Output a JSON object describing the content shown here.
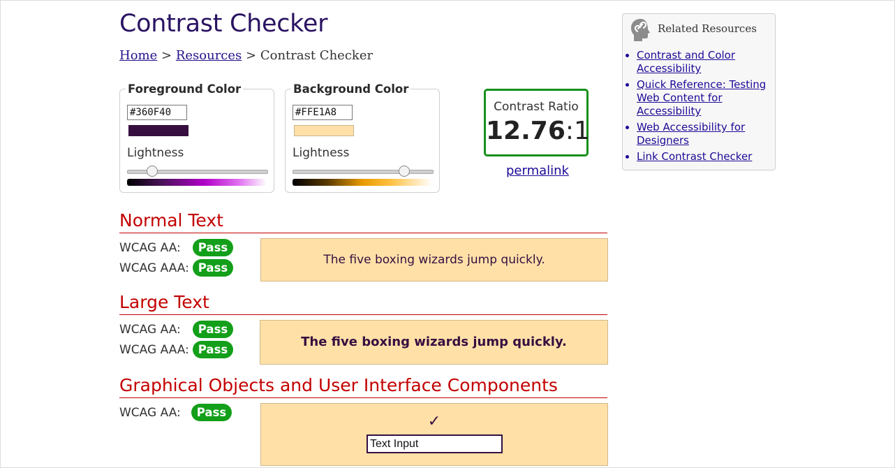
{
  "page": {
    "title": "Contrast Checker"
  },
  "breadcrumb": {
    "home": "Home",
    "sep1": ">",
    "resources": "Resources",
    "sep2": ">",
    "current": "Contrast Checker"
  },
  "foreground": {
    "legend": "Foreground Color",
    "hex": "#360F40",
    "swatch_color": "#360F40",
    "lightness_label": "Lightness",
    "lightness_value": 0.18
  },
  "background": {
    "legend": "Background Color",
    "hex": "#FFE1A8",
    "swatch_color": "#FFE1A8",
    "lightness_label": "Lightness",
    "lightness_value": 0.8
  },
  "ratio": {
    "label": "Contrast Ratio",
    "value": "12.76",
    "suffix": ":1",
    "permalink": "permalink"
  },
  "normal": {
    "heading": "Normal Text",
    "aa_label": "WCAG AA:",
    "aa_result": "Pass",
    "aaa_label": "WCAG AAA:",
    "aaa_result": "Pass",
    "sample": "The five boxing wizards jump quickly."
  },
  "large": {
    "heading": "Large Text",
    "aa_label": "WCAG AA:",
    "aa_result": "Pass",
    "aaa_label": "WCAG AAA:",
    "aaa_result": "Pass",
    "sample": "The five boxing wizards jump quickly."
  },
  "graphics": {
    "heading": "Graphical Objects and User Interface Components",
    "aa_label": "WCAG AA:",
    "aa_result": "Pass",
    "checkmark": "✓",
    "input_value": "Text Input"
  },
  "sidebar": {
    "title": "Related Resources",
    "icon": "link-icon",
    "items": [
      {
        "label": "Contrast and Color Accessibility"
      },
      {
        "label": "Quick Reference: Testing Web Content for Accessibility"
      },
      {
        "label": "Web Accessibility for Designers"
      },
      {
        "label": "Link Contrast Checker"
      }
    ]
  },
  "colors": {
    "pass_green": "#139F19",
    "heading_red": "#C40000",
    "title_purple": "#2A1362",
    "link_blue": "#1C0A96"
  }
}
